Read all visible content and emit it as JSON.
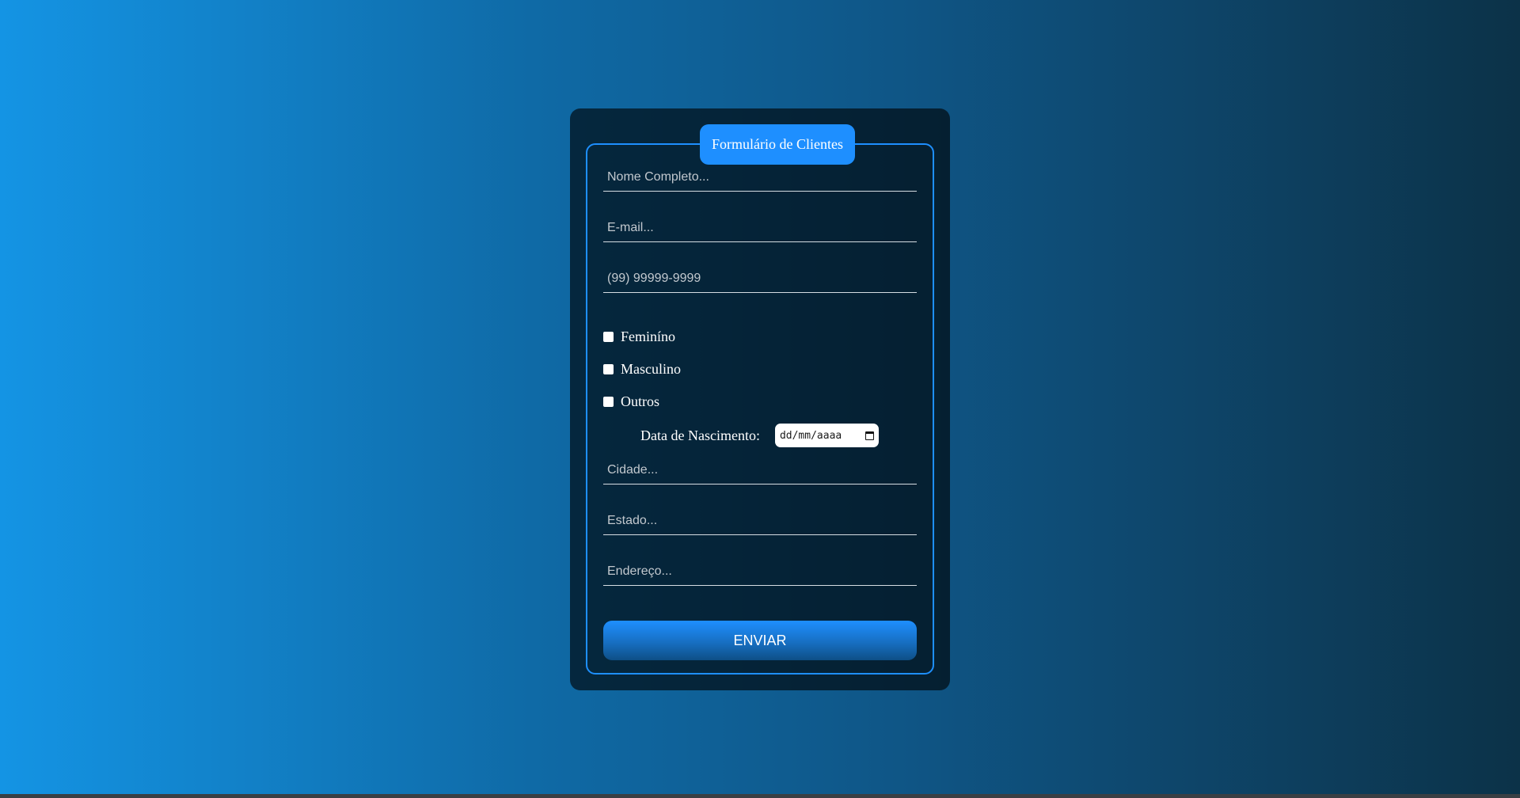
{
  "form": {
    "legend": "Formulário de Clientes",
    "fields": {
      "nome": {
        "placeholder": "Nome Completo...",
        "value": ""
      },
      "email": {
        "placeholder": "E-mail...",
        "value": ""
      },
      "telefone": {
        "placeholder": "(99) 99999-9999",
        "value": ""
      },
      "cidade": {
        "placeholder": "Cidade...",
        "value": ""
      },
      "estado": {
        "placeholder": "Estado...",
        "value": ""
      },
      "endereco": {
        "placeholder": "Endereço...",
        "value": ""
      }
    },
    "genero": [
      {
        "label": "Feminíno",
        "checked": false
      },
      {
        "label": "Masculino",
        "checked": false
      },
      {
        "label": "Outros",
        "checked": false
      }
    ],
    "nascimento": {
      "label": "Data de Nascimento:",
      "placeholder": "dd/mm/aaaa",
      "icon": "calendar-icon"
    },
    "submit_label": "ENVIAR"
  },
  "colors": {
    "accent": "#1e8fff",
    "card_background": "#0b1e2b",
    "text": "#ffffff"
  }
}
